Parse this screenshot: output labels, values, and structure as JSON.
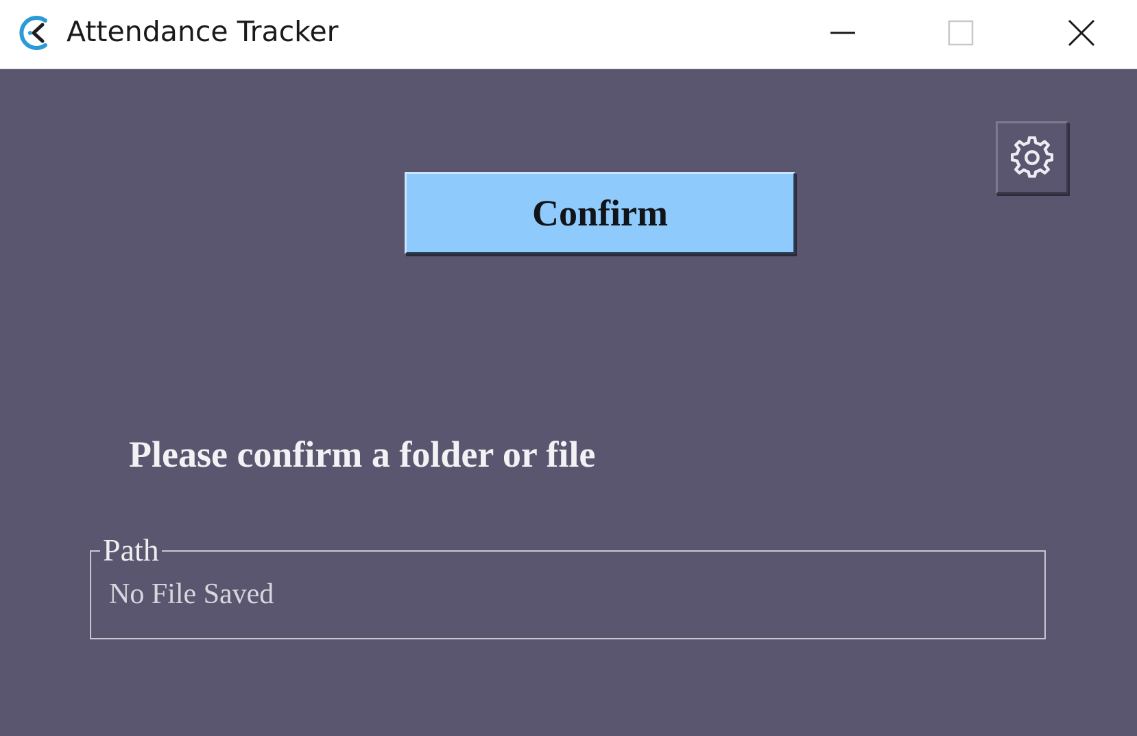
{
  "window": {
    "title": "Attendance Tracker",
    "icon": "app-logo-icon",
    "controls": [
      "minimize-icon",
      "maximize-icon",
      "close-icon"
    ]
  },
  "main": {
    "confirm_label": "Confirm",
    "settings_icon": "gear-icon",
    "prompt": "Please confirm a folder or file",
    "path": {
      "label": "Path",
      "value": "No File Saved"
    }
  },
  "colors": {
    "background": "#5a5670",
    "confirm_button": "#8ecafb",
    "titlebar": "#ffffff",
    "accent_logo": "#2b9bd6"
  }
}
